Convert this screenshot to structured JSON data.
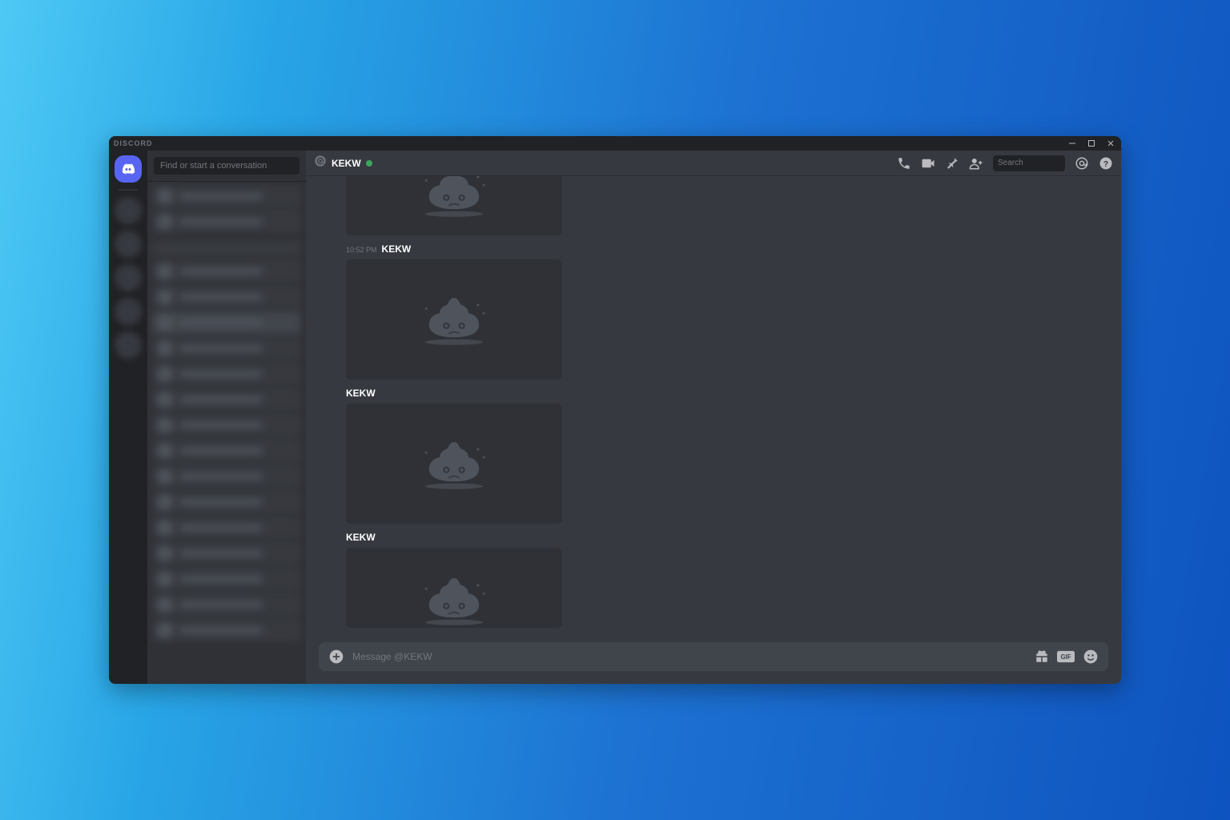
{
  "app": {
    "title": "DISCORD"
  },
  "sidebar": {
    "find_placeholder": "Find or start a conversation"
  },
  "header": {
    "channel_name": "KEKW",
    "search_placeholder": "Search"
  },
  "messages": [
    {
      "timestamp": "",
      "username": "",
      "has_embed": true
    },
    {
      "timestamp": "10:52 PM",
      "username": "KEKW",
      "has_embed": true
    },
    {
      "timestamp": "",
      "username": "KEKW",
      "has_embed": true
    },
    {
      "timestamp": "",
      "username": "KEKW",
      "has_embed": true
    }
  ],
  "composer": {
    "placeholder": "Message @KEKW"
  }
}
